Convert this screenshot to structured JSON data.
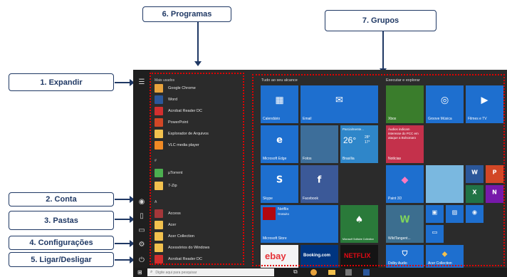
{
  "callouts": {
    "expand": "1. Expandir",
    "account": "2. Conta",
    "folders": "3. Pastas",
    "settings": "4. Configurações",
    "power": "5. Ligar/Desligar",
    "programs": "6. Programas",
    "groups": "7. Grupos"
  },
  "apps": {
    "most_used_header": "Mais usados",
    "hash_header": "#",
    "a_header": "A",
    "items": [
      {
        "name": "Google Chrome",
        "icon": "chrome-icon",
        "color": "#e8a33d"
      },
      {
        "name": "Word",
        "icon": "word-icon",
        "color": "#2b579a"
      },
      {
        "name": "Acrobat Reader DC",
        "icon": "acrobat-icon",
        "color": "#d32f2f"
      },
      {
        "name": "PowerPoint",
        "icon": "powerpoint-icon",
        "color": "#d24726"
      },
      {
        "name": "Explorador de Arquivos",
        "icon": "folder-icon",
        "color": "#f2c14e"
      },
      {
        "name": "VLC media player",
        "icon": "vlc-icon",
        "color": "#f08a24"
      },
      {
        "name": "µTorrent",
        "icon": "utorrent-icon",
        "color": "#4caf50"
      },
      {
        "name": "7-Zip",
        "icon": "7zip-icon",
        "color": "#f2c14e"
      },
      {
        "name": "Access",
        "icon": "access-icon",
        "color": "#a4373a"
      },
      {
        "name": "Acer",
        "icon": "acer-icon",
        "color": "#f2c14e"
      },
      {
        "name": "Acer Collection",
        "icon": "acer-collection-icon",
        "color": "#f2c14e"
      },
      {
        "name": "Acessórios do Windows",
        "icon": "folder-icon",
        "color": "#f2c14e"
      },
      {
        "name": "Acrobat Reader DC",
        "icon": "acrobat-icon",
        "color": "#d32f2f"
      }
    ]
  },
  "groups": {
    "left_title": "Tudo ao seu alcance",
    "right_title": "Executar e explorar"
  },
  "tiles": {
    "calendar": "Calendário",
    "mail": "Email",
    "edge": "Microsoft Edge",
    "photos": "Fotos",
    "weather_desc": "Parcialmente...",
    "weather_temp": "26°",
    "weather_hi": "28°",
    "weather_lo": "17°",
    "weather_city": "Brasília",
    "skype": "Skype",
    "facebook": "Facebook",
    "netflix_name": "Netflix",
    "netflix_price": "Gratuito",
    "store": "Microsoft Store",
    "solitaire": "Microsoft Solitaire Collection",
    "xbox": "Xbox",
    "groove": "Groove Música",
    "movies": "Filmes e TV",
    "news": "Áudios indicam interesse do PCC em ataque a Bolsonaro",
    "news_label": "Notícias",
    "paint3d": "Paint 3D",
    "wildtangent": "WildTangent...",
    "dolby": "Dolby Audio",
    "acer_collection": "Acer Collection",
    "ebay": "ebay",
    "booking": "Booking.com",
    "netflix_logo": "NETFLIX"
  },
  "taskbar": {
    "search_placeholder": "Digite aqui para pesquisar"
  },
  "colors": {
    "tile_blue": "#1e6fcf",
    "menu_bg": "#2b2b2b",
    "highlight": "#e00000",
    "callout": "#1f3864"
  }
}
